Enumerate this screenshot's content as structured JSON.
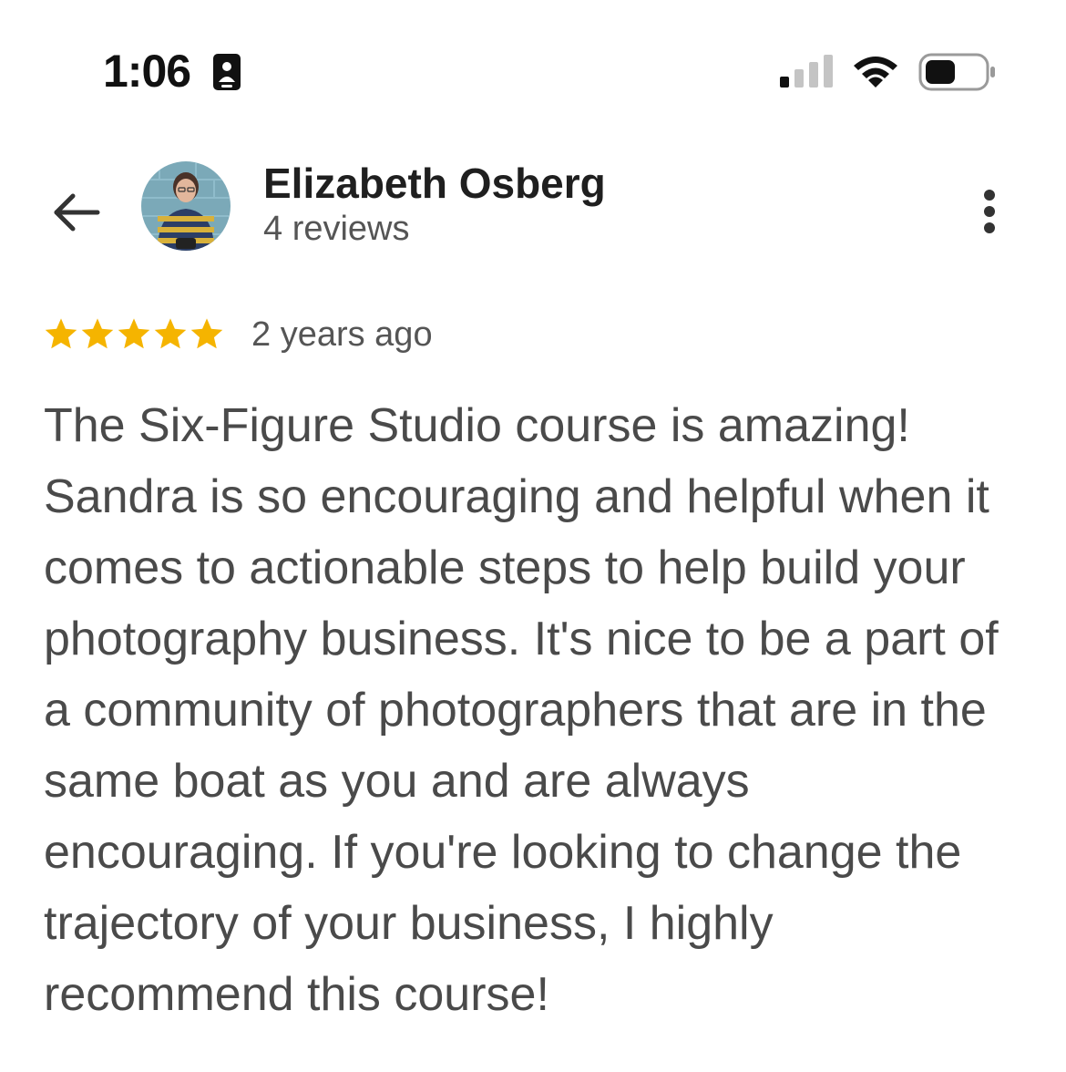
{
  "status_bar": {
    "time": "1:06",
    "icons": [
      "id-card-icon",
      "cellular-signal-icon",
      "wifi-icon",
      "battery-icon"
    ],
    "signal_bars_active": 1
  },
  "header": {
    "back_icon": "arrow-left-icon",
    "reviewer_name": "Elizabeth Osberg",
    "review_count": "4 reviews",
    "more_icon": "more-vertical-icon"
  },
  "review": {
    "rating": 5,
    "rating_max": 5,
    "date": "2 years ago",
    "text": "The Six-Figure Studio course is amazing! Sandra is so encouraging and helpful when it comes to actionable steps to help build your photography business. It's nice to be a part of a community of photographers that are in the same boat as you and are always encouraging. If you're looking to change the trajectory of your business, I highly recommend this course!"
  },
  "colors": {
    "star": "#f5b400",
    "text": "#4a4a4a",
    "name": "#1f1f1f",
    "meta": "#555555"
  }
}
